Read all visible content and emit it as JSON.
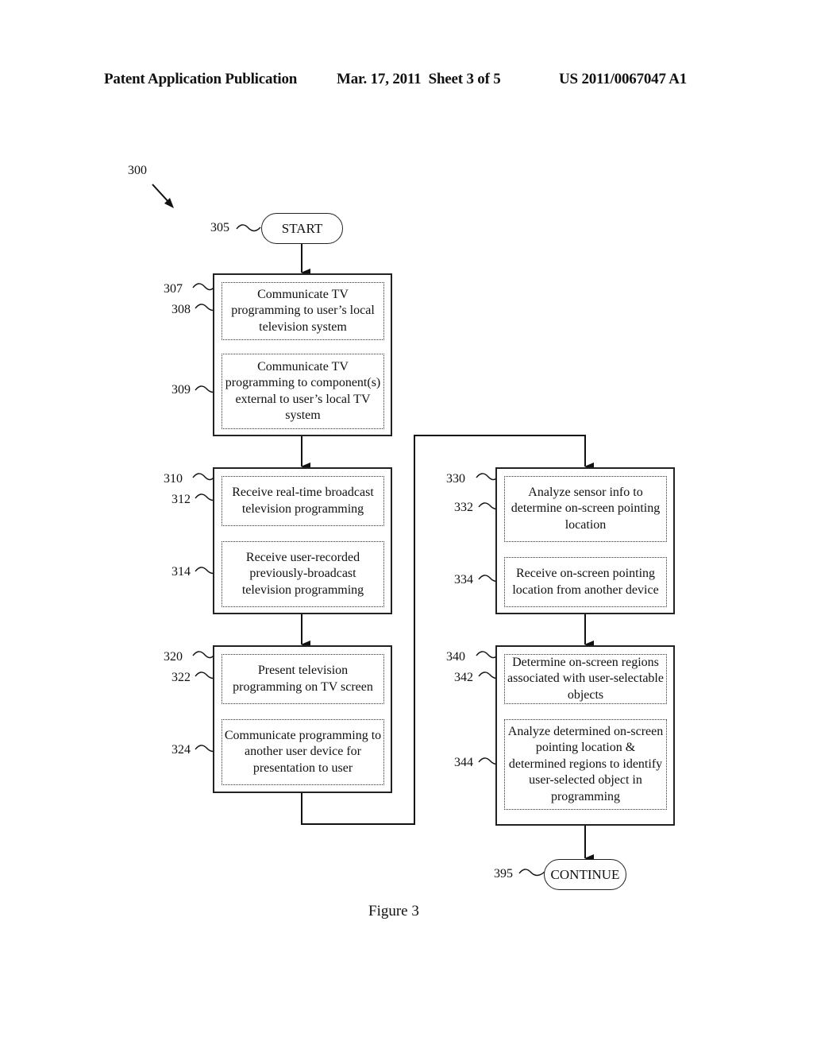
{
  "header": {
    "publication": "Patent Application Publication",
    "date_sheet": "Mar. 17, 2011  Sheet 3 of 5",
    "number": "US 2011/0067047 A1"
  },
  "figure": {
    "ref": "300",
    "caption": "Figure 3",
    "start": {
      "ref": "305",
      "label": "START"
    },
    "end": {
      "ref": "395",
      "label": "CONTINUE"
    },
    "blocks": [
      {
        "ref": "307",
        "steps": [
          {
            "ref": "308",
            "text": "Communicate TV programming to user’s local television system"
          },
          {
            "ref": "309",
            "text": "Communicate TV programming to component(s) external to user’s local TV system"
          }
        ]
      },
      {
        "ref": "310",
        "steps": [
          {
            "ref": "312",
            "text": "Receive real-time broadcast television programming"
          },
          {
            "ref": "314",
            "text": "Receive user-recorded previously-broadcast television programming"
          }
        ]
      },
      {
        "ref": "320",
        "steps": [
          {
            "ref": "322",
            "text": "Present television programming on TV screen"
          },
          {
            "ref": "324",
            "text": "Communicate programming to another user device for presentation to user"
          }
        ]
      },
      {
        "ref": "330",
        "steps": [
          {
            "ref": "332",
            "text": "Analyze sensor info to determine on-screen pointing location"
          },
          {
            "ref": "334",
            "text": "Receive on-screen pointing location from another device"
          }
        ]
      },
      {
        "ref": "340",
        "steps": [
          {
            "ref": "342",
            "text": "Determine on-screen regions associated with user-selectable objects"
          },
          {
            "ref": "344",
            "text": "Analyze determined on-screen pointing location & determined regions to identify user-selected object in programming"
          }
        ]
      }
    ]
  }
}
